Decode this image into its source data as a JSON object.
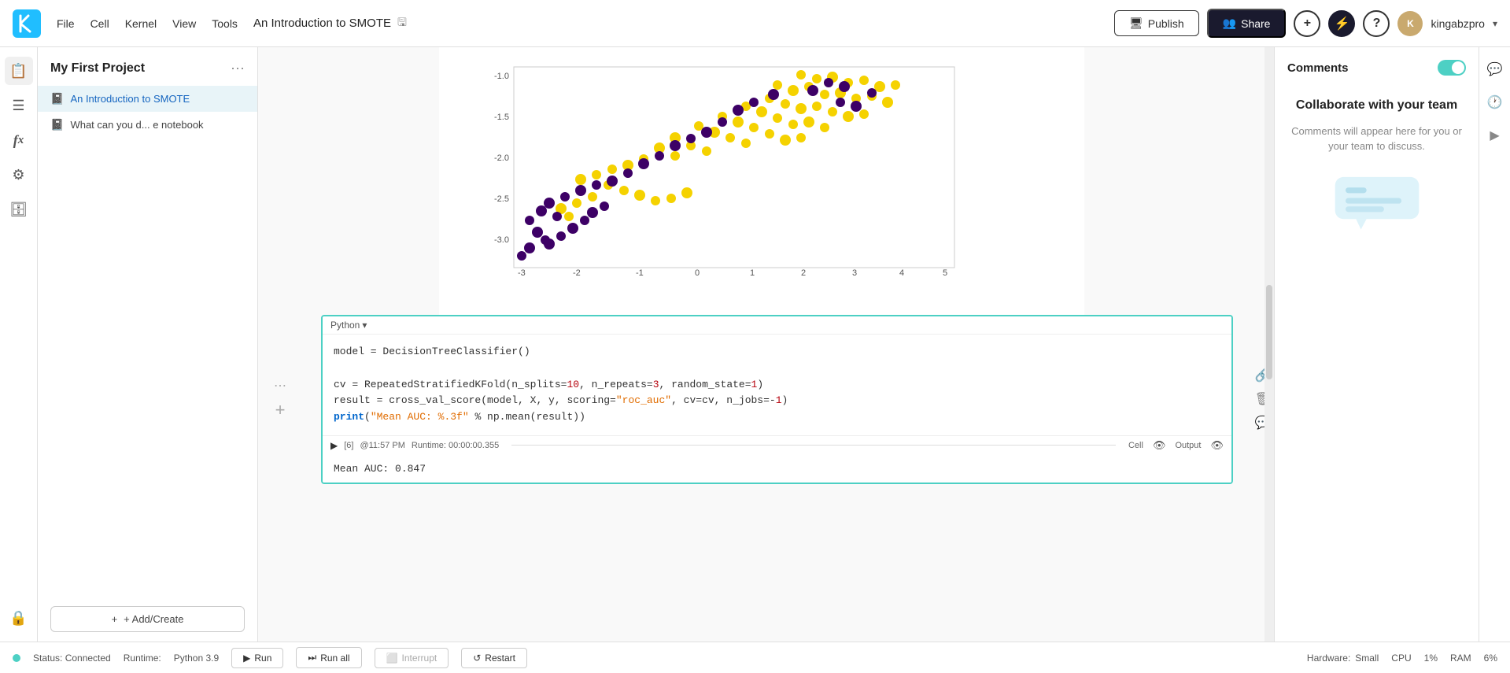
{
  "topbar": {
    "logo_label": "Kaggle",
    "notebook_name": "An Introduction to SMOTE",
    "menus": [
      "File",
      "Cell",
      "Kernel",
      "View",
      "Tools"
    ],
    "publish_label": "Publish",
    "share_label": "Share",
    "add_label": "+",
    "activity_label": "⚡",
    "help_label": "?",
    "username": "kingabzpro",
    "dropdown_arrow": "▾"
  },
  "sidebar": {
    "project_title": "My First Project",
    "more_label": "···",
    "files": [
      {
        "name": "An Introduction to SMOTE",
        "icon": "📓",
        "active": true
      },
      {
        "name": "What can you d... e notebook",
        "icon": "📓",
        "active": false
      }
    ],
    "add_create_label": "+ Add/Create"
  },
  "cell": {
    "language": "Python",
    "run_number": "[6]",
    "timestamp": "@11:57 PM",
    "runtime": "Runtime: 00:00:00.355",
    "cell_label": "Cell",
    "output_label": "Output",
    "code_lines": [
      "model = DecisionTreeClassifier()",
      "",
      "cv = RepeatedStratifiedKFold(n_splits=10, n_repeats=3, random_state=1)",
      "result = cross_val_score(model, X, y, scoring=\"roc_auc\", cv=cv, n_jobs=-1)",
      "print(\"Mean AUC: %.3f\" % np.mean(result))"
    ],
    "output_text": "Mean AUC: 0.847"
  },
  "comments_panel": {
    "title": "Comments",
    "collaborate_title": "Collaborate with your team",
    "description": "Comments will appear here for you or your team to discuss."
  },
  "bottombar": {
    "status_label": "Status: Connected",
    "runtime_label": "Runtime:",
    "runtime_value": "Python 3.9",
    "run_label": "Run",
    "run_all_label": "Run all",
    "interrupt_label": "Interrupt",
    "restart_label": "Restart",
    "hardware_label": "Hardware:",
    "hardware_value": "Small",
    "cpu_label": "CPU",
    "cpu_value": "1%",
    "ram_label": "RAM",
    "ram_value": "6%"
  },
  "chart": {
    "x_ticks": [
      "-3",
      "-2",
      "-1",
      "0",
      "1",
      "2",
      "3",
      "4",
      "5"
    ],
    "y_ticks": [
      "-1.0",
      "-1.5",
      "-2.0",
      "-2.5",
      "-3.0"
    ],
    "color_yellow": "#f5d200",
    "color_purple": "#3d0066"
  }
}
